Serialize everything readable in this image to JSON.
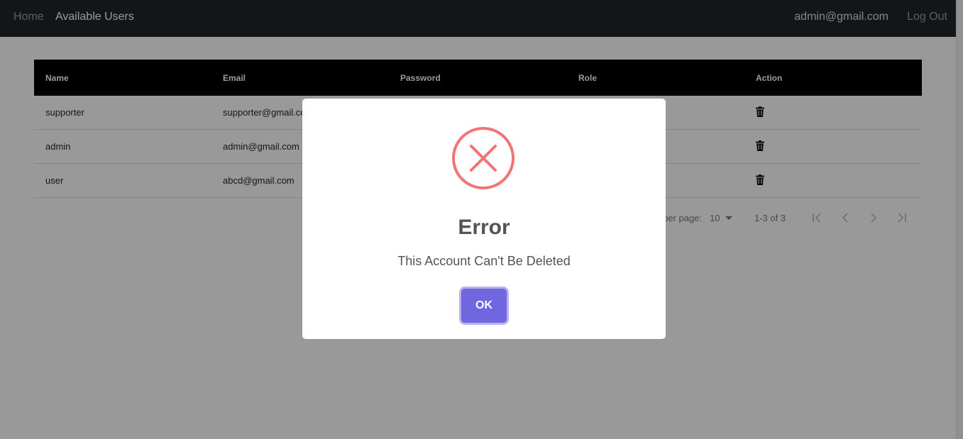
{
  "navbar": {
    "home_label": "Home",
    "users_label": "Available Users",
    "user_email": "admin@gmail.com",
    "logout_label": "Log Out"
  },
  "table": {
    "headers": [
      "Name",
      "Email",
      "Password",
      "Role",
      "Action"
    ],
    "rows": [
      {
        "name": "supporter",
        "email": "supporter@gmail.com"
      },
      {
        "name": "admin",
        "email": "admin@gmail.com"
      },
      {
        "name": "user",
        "email": "abcd@gmail.com"
      }
    ],
    "row_action_icon": "trash-icon",
    "pagination": {
      "rows_per_page_label": "Rows per page:",
      "rows_per_page_value": "10",
      "range_text": "1-3 of 3",
      "icons": [
        "first-page-icon",
        "previous-page-icon",
        "next-page-icon",
        "last-page-icon"
      ]
    }
  },
  "modal": {
    "icon": "error-x-icon",
    "title": "Error",
    "message": "This Account Can't Be Deleted",
    "ok_label": "OK"
  },
  "colors": {
    "navbar": "#212529",
    "table_header": "#000000",
    "error_icon": "#f27474",
    "confirm_button": "#7066e0",
    "overlay": "rgba(0,0,0,0.4)"
  }
}
